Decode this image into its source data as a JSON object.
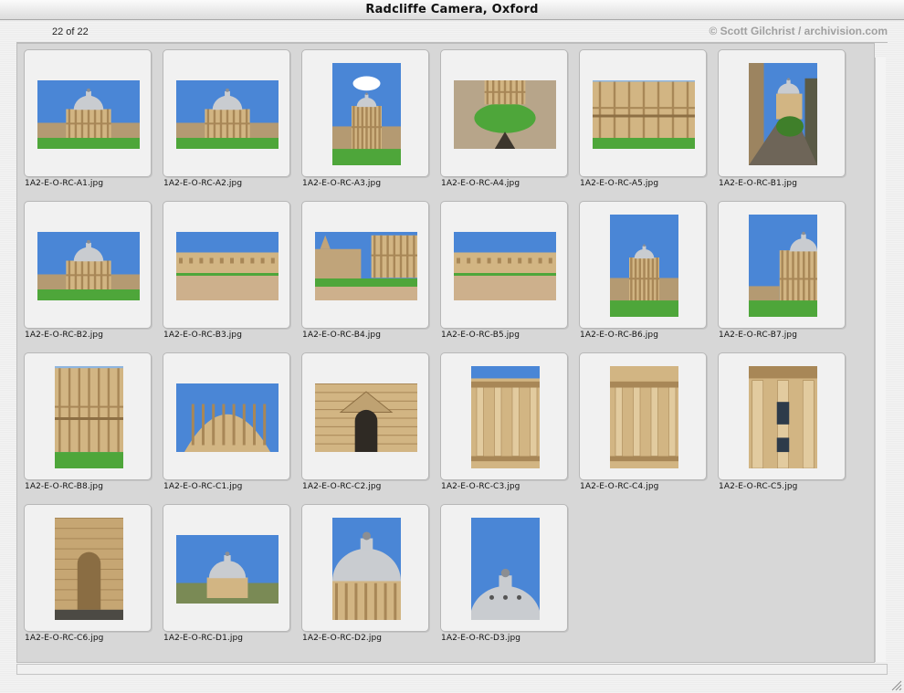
{
  "window": {
    "title": "Radcliffe Camera, Oxford"
  },
  "info": {
    "count": "22 of 22",
    "credit": "© Scott Gilchrist / archivision.com"
  },
  "thumbnails": [
    {
      "filename": "1A2-E-O-RC-A1.jpg",
      "orientation": "landscape",
      "kind": "dome-far"
    },
    {
      "filename": "1A2-E-O-RC-A2.jpg",
      "orientation": "landscape",
      "kind": "dome-far"
    },
    {
      "filename": "1A2-E-O-RC-A3.jpg",
      "orientation": "square",
      "kind": "dome-cloud"
    },
    {
      "filename": "1A2-E-O-RC-A4.jpg",
      "orientation": "landscape",
      "kind": "aerial-lawn"
    },
    {
      "filename": "1A2-E-O-RC-A5.jpg",
      "orientation": "landscape",
      "kind": "drum-lawn"
    },
    {
      "filename": "1A2-E-O-RC-B1.jpg",
      "orientation": "portrait",
      "kind": "lane"
    },
    {
      "filename": "1A2-E-O-RC-B2.jpg",
      "orientation": "landscape",
      "kind": "dome-blue"
    },
    {
      "filename": "1A2-E-O-RC-B3.jpg",
      "orientation": "landscape",
      "kind": "courtyard"
    },
    {
      "filename": "1A2-E-O-RC-B4.jpg",
      "orientation": "landscape",
      "kind": "quad"
    },
    {
      "filename": "1A2-E-O-RC-B5.jpg",
      "orientation": "landscape",
      "kind": "courtyard2"
    },
    {
      "filename": "1A2-E-O-RC-B6.jpg",
      "orientation": "portrait",
      "kind": "dome-blue"
    },
    {
      "filename": "1A2-E-O-RC-B7.jpg",
      "orientation": "portrait",
      "kind": "dome-side"
    },
    {
      "filename": "1A2-E-O-RC-B8.jpg",
      "orientation": "portrait",
      "kind": "drum-lawn"
    },
    {
      "filename": "1A2-E-O-RC-C1.jpg",
      "orientation": "landscape",
      "kind": "drum-sky"
    },
    {
      "filename": "1A2-E-O-RC-C2.jpg",
      "orientation": "landscape",
      "kind": "arch"
    },
    {
      "filename": "1A2-E-O-RC-C3.jpg",
      "orientation": "portrait",
      "kind": "columns"
    },
    {
      "filename": "1A2-E-O-RC-C4.jpg",
      "orientation": "portrait",
      "kind": "columns-tan"
    },
    {
      "filename": "1A2-E-O-RC-C5.jpg",
      "orientation": "portrait",
      "kind": "window"
    },
    {
      "filename": "1A2-E-O-RC-C6.jpg",
      "orientation": "portrait",
      "kind": "niche"
    },
    {
      "filename": "1A2-E-O-RC-D1.jpg",
      "orientation": "landscape",
      "kind": "dome-skyline"
    },
    {
      "filename": "1A2-E-O-RC-D2.jpg",
      "orientation": "square",
      "kind": "dome-close"
    },
    {
      "filename": "1A2-E-O-RC-D3.jpg",
      "orientation": "square",
      "kind": "dome-top"
    }
  ],
  "colors": {
    "sky": "#4a86d6",
    "stone": "#d2b583",
    "stone_dark": "#a88757",
    "lawn": "#4ea63a",
    "dome": "#c9ccd0"
  }
}
